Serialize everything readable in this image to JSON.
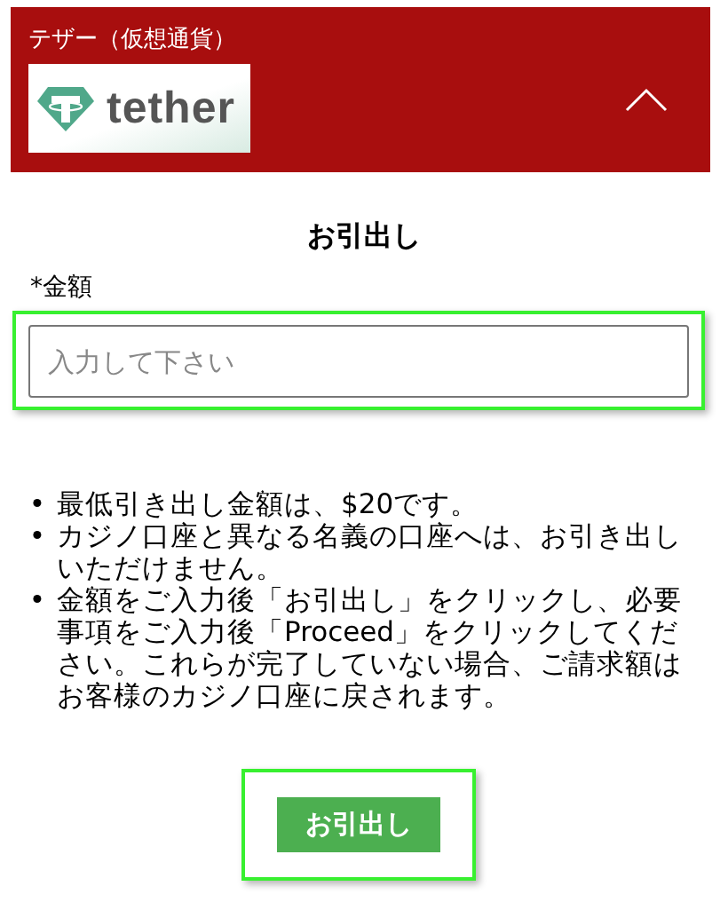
{
  "header": {
    "title": "テザー（仮想通貨）",
    "logo_text": "tether",
    "expanded": true
  },
  "form": {
    "heading": "お引出し",
    "amount_label": "*金額",
    "amount_placeholder": "入力して下さい"
  },
  "notes": [
    {
      "bullet": "•",
      "text": "最低引き出し金額は、$20です。"
    },
    {
      "bullet": "•",
      "text": "カジノ口座と異なる名義の口座へは、お引き出しいただけません。"
    },
    {
      "bullet": "•",
      "text": "金額をご入力後「お引出し」をクリックし、必要事項をご入力後「Proceed」をクリックしてください。これらが完了していない場合、ご請求額はお客様のカジノ口座に戻されます。"
    }
  ],
  "submit_button": "お引出し"
}
